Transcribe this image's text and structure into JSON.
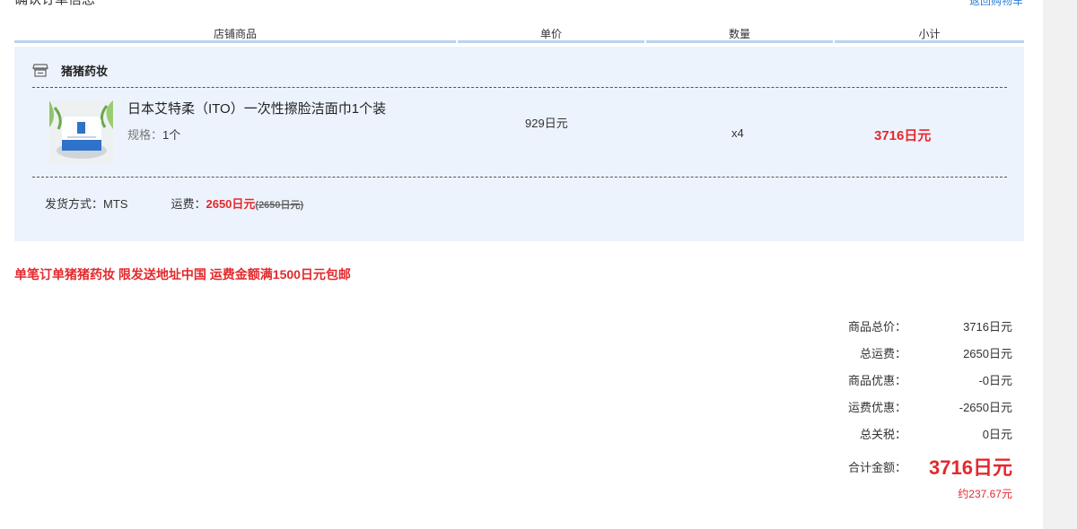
{
  "section_title": "确认订单信息",
  "corner_link": "返回购物车",
  "table_header": {
    "col1": "店铺商品",
    "col2": "单价",
    "col3": "数量",
    "col4": "小计"
  },
  "shop": {
    "name": "猪猪药妆",
    "icon": "store-icon"
  },
  "item": {
    "name": "日本艾特柔（ITO）一次性擦脸洁面巾1个装",
    "spec_label": "规格：",
    "spec_value": "1个",
    "unit_price": "929日元",
    "quantity": "x4",
    "subtotal": "3716日元"
  },
  "shipping": {
    "method_label": "发货方式：",
    "method_value": "MTS",
    "fee_label": "运费：",
    "fee_value": "2650日元",
    "fee_original": "(2650日元)"
  },
  "notice": "单笔订单猪猪药妆 限发送地址中国 运费金额满1500日元包邮",
  "summary": {
    "rows": [
      {
        "label": "商品总价：",
        "value": "3716日元"
      },
      {
        "label": "总运费：",
        "value": "2650日元"
      },
      {
        "label": "商品优惠：",
        "value": "-0日元"
      },
      {
        "label": "运费优惠：",
        "value": "-2650日元"
      },
      {
        "label": "总关税：",
        "value": "0日元"
      }
    ],
    "total_label": "合计金额：",
    "total_value": "3716日元",
    "approx": "约237.67元"
  },
  "colors": {
    "accent_red": "#e4282c",
    "panel_bg": "#edf3fd",
    "header_rule": "#b9d3f3"
  }
}
